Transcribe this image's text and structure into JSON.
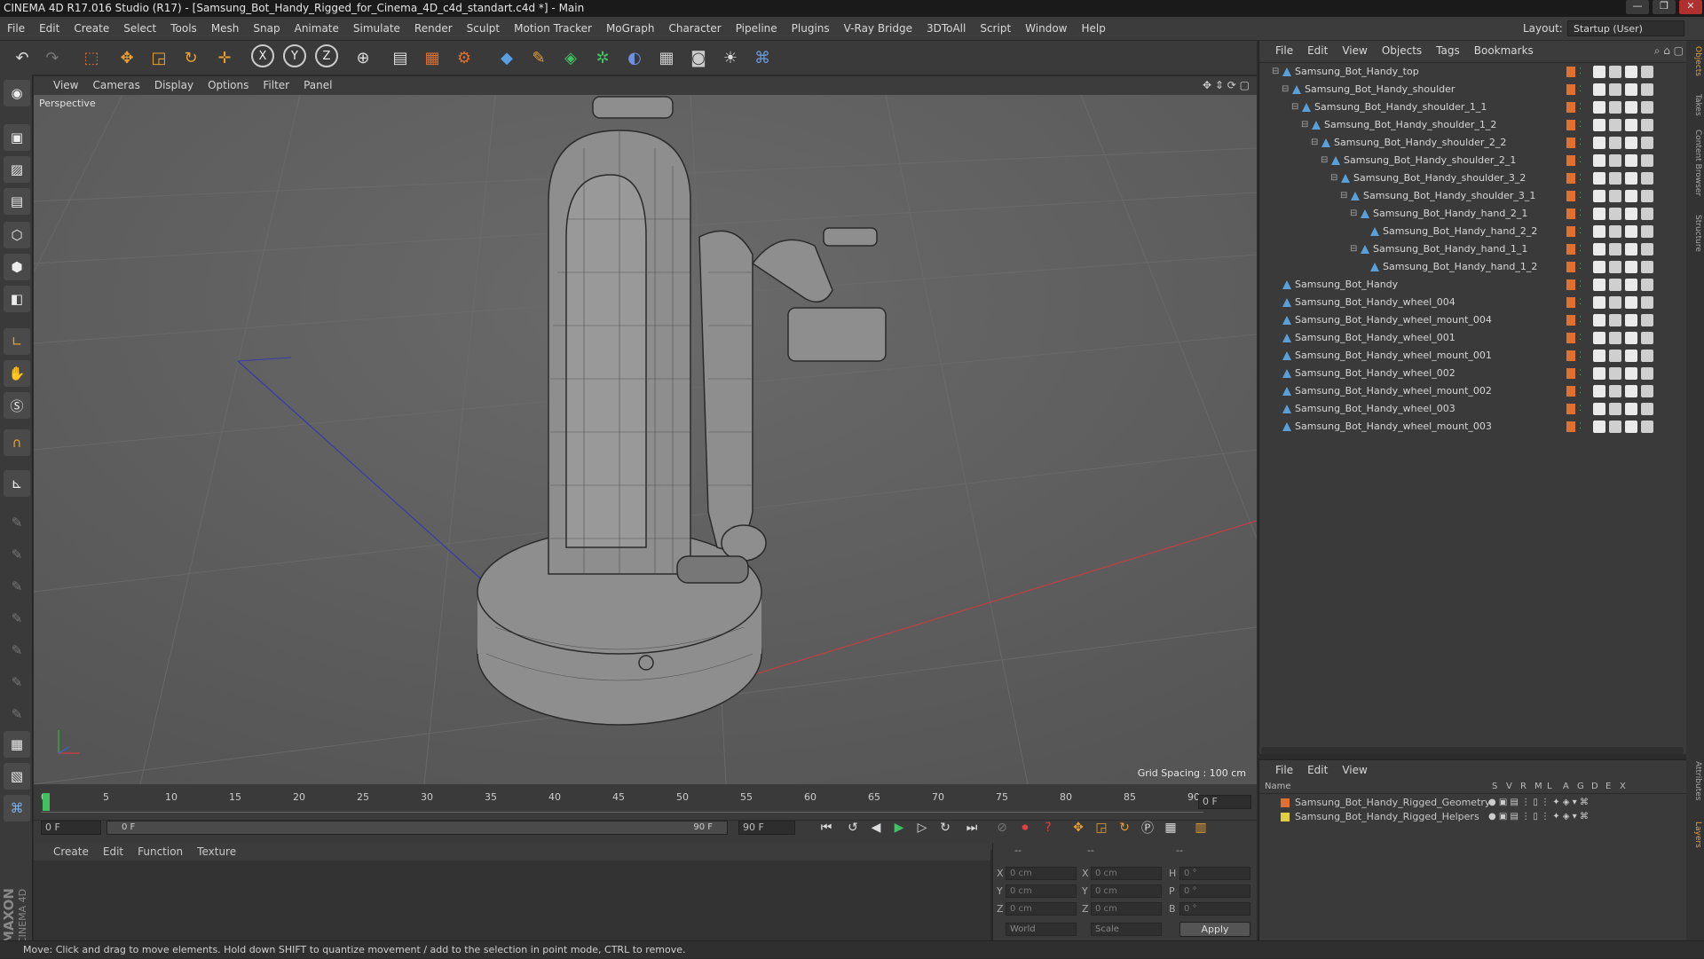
{
  "window": {
    "title": "CINEMA 4D R17.016 Studio (R17) - [Samsung_Bot_Handy_Rigged_for_Cinema_4D_c4d_standart.c4d *] - Main",
    "controls": [
      "—",
      "❐",
      "✕"
    ]
  },
  "menubar": {
    "items": [
      "File",
      "Edit",
      "Create",
      "Select",
      "Tools",
      "Mesh",
      "Snap",
      "Animate",
      "Simulate",
      "Render",
      "Sculpt",
      "Motion Tracker",
      "MoGraph",
      "Character",
      "Pipeline",
      "Plugins",
      "V-Ray Bridge",
      "3DToAll",
      "Script",
      "Window",
      "Help"
    ],
    "layout_label": "Layout:",
    "layout_value": "Startup (User)"
  },
  "toolbar": {
    "axis_x": "X",
    "axis_y": "Y",
    "axis_z": "Z"
  },
  "viewport": {
    "menu": [
      "View",
      "Cameras",
      "Display",
      "Options",
      "Filter",
      "Panel"
    ],
    "label": "Perspective",
    "grid_spacing": "Grid Spacing : 100 cm"
  },
  "timeline": {
    "ticks": [
      "0",
      "5",
      "10",
      "15",
      "20",
      "25",
      "30",
      "35",
      "40",
      "45",
      "50",
      "55",
      "60",
      "65",
      "70",
      "75",
      "80",
      "85",
      "90"
    ],
    "frame_end_field": "0 F"
  },
  "transport": {
    "start_field": "0 F",
    "range_start": "0 F",
    "range_end": "90 F",
    "end_field": "90 F"
  },
  "material_manager": {
    "menu": [
      "Create",
      "Edit",
      "Function",
      "Texture"
    ]
  },
  "coordinates": {
    "rows": [
      {
        "a": "X",
        "av": "0 cm",
        "b": "X",
        "bv": "0 cm",
        "c": "H",
        "cv": "0 °"
      },
      {
        "a": "Y",
        "av": "0 cm",
        "b": "Y",
        "bv": "0 cm",
        "c": "P",
        "cv": "0 °"
      },
      {
        "a": "Z",
        "av": "0 cm",
        "b": "Z",
        "bv": "0 cm",
        "c": "B",
        "cv": "0 °"
      }
    ],
    "mode": "World",
    "scale": "Scale",
    "apply": "Apply",
    "dash1": "--",
    "dash2": "--",
    "dash3": "--"
  },
  "object_manager": {
    "menu": [
      "File",
      "Edit",
      "View",
      "Objects",
      "Tags",
      "Bookmarks"
    ],
    "items": [
      {
        "name": "Samsung_Bot_Handy_top",
        "indent": 0,
        "expanded": true
      },
      {
        "name": "Samsung_Bot_Handy_shoulder",
        "indent": 1,
        "expanded": true
      },
      {
        "name": "Samsung_Bot_Handy_shoulder_1_1",
        "indent": 2,
        "expanded": true
      },
      {
        "name": "Samsung_Bot_Handy_shoulder_1_2",
        "indent": 3,
        "expanded": true
      },
      {
        "name": "Samsung_Bot_Handy_shoulder_2_2",
        "indent": 4,
        "expanded": true
      },
      {
        "name": "Samsung_Bot_Handy_shoulder_2_1",
        "indent": 5,
        "expanded": true
      },
      {
        "name": "Samsung_Bot_Handy_shoulder_3_2",
        "indent": 6,
        "expanded": true
      },
      {
        "name": "Samsung_Bot_Handy_shoulder_3_1",
        "indent": 7,
        "expanded": true
      },
      {
        "name": "Samsung_Bot_Handy_hand_2_1",
        "indent": 8,
        "expanded": true
      },
      {
        "name": "Samsung_Bot_Handy_hand_2_2",
        "indent": 9,
        "expanded": false
      },
      {
        "name": "Samsung_Bot_Handy_hand_1_1",
        "indent": 8,
        "expanded": true
      },
      {
        "name": "Samsung_Bot_Handy_hand_1_2",
        "indent": 9,
        "expanded": false
      },
      {
        "name": "Samsung_Bot_Handy",
        "indent": 0,
        "expanded": false
      },
      {
        "name": "Samsung_Bot_Handy_wheel_004",
        "indent": 0,
        "expanded": false
      },
      {
        "name": "Samsung_Bot_Handy_wheel_mount_004",
        "indent": 0,
        "expanded": false
      },
      {
        "name": "Samsung_Bot_Handy_wheel_001",
        "indent": 0,
        "expanded": false
      },
      {
        "name": "Samsung_Bot_Handy_wheel_mount_001",
        "indent": 0,
        "expanded": false
      },
      {
        "name": "Samsung_Bot_Handy_wheel_002",
        "indent": 0,
        "expanded": false
      },
      {
        "name": "Samsung_Bot_Handy_wheel_mount_002",
        "indent": 0,
        "expanded": false
      },
      {
        "name": "Samsung_Bot_Handy_wheel_003",
        "indent": 0,
        "expanded": false
      },
      {
        "name": "Samsung_Bot_Handy_wheel_mount_003",
        "indent": 0,
        "expanded": false
      }
    ]
  },
  "layer_manager": {
    "menu": [
      "File",
      "Edit",
      "View"
    ],
    "columns": [
      "Name",
      "S",
      "V",
      "R",
      "M",
      "L",
      "A",
      "G",
      "D",
      "E",
      "X"
    ],
    "layers": [
      {
        "name": "Samsung_Bot_Handy_Rigged_Geometry",
        "color": "#e07030"
      },
      {
        "name": "Samsung_Bot_Handy_Rigged_Helpers",
        "color": "#e0d040"
      }
    ]
  },
  "right_tabs": [
    "Objects",
    "Takes",
    "Content Browser",
    "Structure",
    "Attributes",
    "Layers"
  ],
  "status": {
    "text": "Move: Click and drag to move elements. Hold down SHIFT to quantize movement / add to the selection in point mode, CTRL to remove."
  },
  "brand": {
    "line1": "MAXON",
    "line2": "CINEMA 4D"
  },
  "colors": {
    "accent": "#e07030",
    "axis_x": "#c04040",
    "axis_y": "#3a3aa8",
    "viewport_bg": "#5f5f5f",
    "helpers_layer": "#e0d040"
  }
}
